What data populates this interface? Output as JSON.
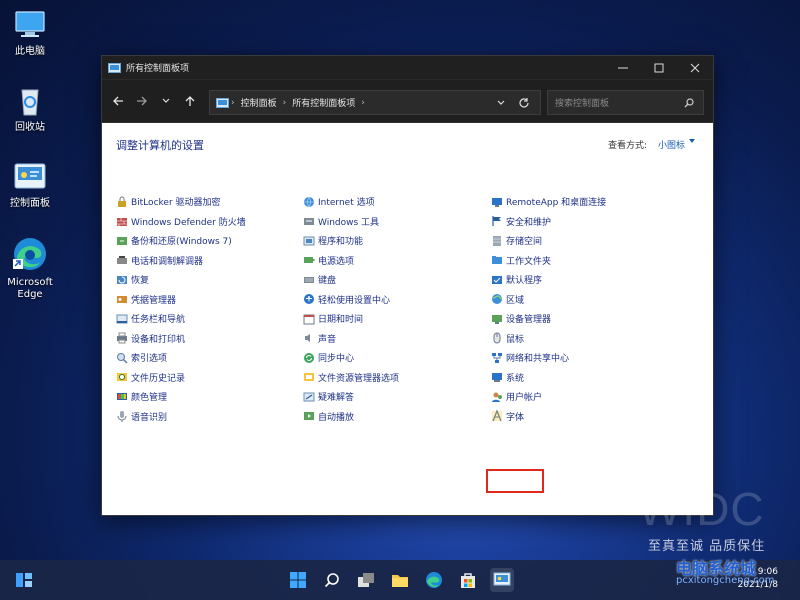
{
  "desktop": {
    "icons": [
      {
        "label": "此电脑",
        "icon": "computer-icon"
      },
      {
        "label": "回收站",
        "icon": "recycle-bin-icon"
      },
      {
        "label": "控制面板",
        "icon": "control-panel-icon"
      },
      {
        "label": "Microsoft Edge",
        "icon": "edge-icon"
      }
    ]
  },
  "window": {
    "title": "所有控制面板项",
    "path": [
      "控制面板",
      "所有控制面板项"
    ],
    "search_placeholder": "搜索控制面板",
    "heading": "调整计算机的设置",
    "view_by_label": "查看方式:",
    "view_by_value": "小图标",
    "columns": [
      [
        {
          "label": "BitLocker 驱动器加密",
          "icon": "bitlocker-icon"
        },
        {
          "label": "Windows Defender 防火墙",
          "icon": "firewall-icon"
        },
        {
          "label": "备份和还原(Windows 7)",
          "icon": "backup-icon"
        },
        {
          "label": "电话和调制解调器",
          "icon": "phone-modem-icon"
        },
        {
          "label": "恢复",
          "icon": "recovery-icon"
        },
        {
          "label": "凭据管理器",
          "icon": "credential-icon"
        },
        {
          "label": "任务栏和导航",
          "icon": "taskbar-nav-icon"
        },
        {
          "label": "设备和打印机",
          "icon": "printer-icon"
        },
        {
          "label": "索引选项",
          "icon": "index-icon"
        },
        {
          "label": "文件历史记录",
          "icon": "file-history-icon"
        },
        {
          "label": "颜色管理",
          "icon": "color-icon"
        },
        {
          "label": "语音识别",
          "icon": "microphone-icon"
        }
      ],
      [
        {
          "label": "Internet 选项",
          "icon": "internet-icon"
        },
        {
          "label": "Windows 工具",
          "icon": "tools-icon"
        },
        {
          "label": "程序和功能",
          "icon": "programs-icon"
        },
        {
          "label": "电源选项",
          "icon": "power-icon"
        },
        {
          "label": "键盘",
          "icon": "keyboard-icon"
        },
        {
          "label": "轻松使用设置中心",
          "icon": "ease-of-access-icon"
        },
        {
          "label": "日期和时间",
          "icon": "datetime-icon"
        },
        {
          "label": "声音",
          "icon": "sound-icon"
        },
        {
          "label": "同步中心",
          "icon": "sync-icon"
        },
        {
          "label": "文件资源管理器选项",
          "icon": "explorer-options-icon"
        },
        {
          "label": "疑难解答",
          "icon": "troubleshoot-icon"
        },
        {
          "label": "自动播放",
          "icon": "autoplay-icon"
        }
      ],
      [
        {
          "label": "RemoteApp 和桌面连接",
          "icon": "remoteapp-icon"
        },
        {
          "label": "安全和维护",
          "icon": "flag-icon"
        },
        {
          "label": "存储空间",
          "icon": "storage-icon"
        },
        {
          "label": "工作文件夹",
          "icon": "work-folder-icon"
        },
        {
          "label": "默认程序",
          "icon": "default-programs-icon"
        },
        {
          "label": "区域",
          "icon": "region-icon"
        },
        {
          "label": "设备管理器",
          "icon": "device-manager-icon"
        },
        {
          "label": "鼠标",
          "icon": "mouse-icon"
        },
        {
          "label": "网络和共享中心",
          "icon": "network-icon"
        },
        {
          "label": "系统",
          "icon": "system-icon"
        },
        {
          "label": "用户帐户",
          "icon": "user-accounts-icon"
        },
        {
          "label": "字体",
          "icon": "font-icon"
        }
      ]
    ]
  },
  "watermark": {
    "brand": "WIDC",
    "slogan": "至真至诚 品质保住",
    "site": "电脑系统城",
    "url": "pcxitongcheng.com"
  },
  "taskbar": {
    "clock_time": "9:06",
    "clock_date": "2021/1/8"
  },
  "colors": {
    "link": "#1e3287",
    "highlight": "#e0281c"
  }
}
